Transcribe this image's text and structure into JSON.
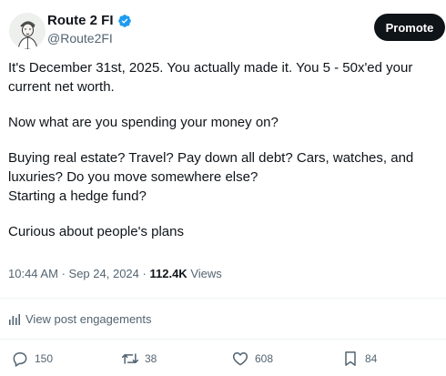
{
  "author": {
    "display_name": "Route 2 FI",
    "handle": "@Route2FI",
    "verified": true
  },
  "promote_label": "Promote",
  "tweet": {
    "paragraphs": [
      "It's December 31st, 2025. You actually made it. You 5 - 50x'ed your current net worth.",
      "Now what are you spending your money on?",
      "Buying real estate? Travel? Pay down all debt? Cars, watches, and luxuries? Do you move somewhere else?",
      "Starting a hedge fund?",
      "Curious about people's plans"
    ]
  },
  "meta": {
    "time": "10:44 AM",
    "separator": "·",
    "date": "Sep 24, 2024",
    "views_count": "112.4K",
    "views_label": "Views"
  },
  "engagements_label": "View post engagements",
  "actions": {
    "replies": "150",
    "reposts": "38",
    "likes": "608",
    "bookmarks": "84"
  },
  "colors": {
    "text": "#0f1419",
    "secondary": "#536471",
    "verified": "#1d9bf0",
    "button_bg": "#0f1419"
  }
}
